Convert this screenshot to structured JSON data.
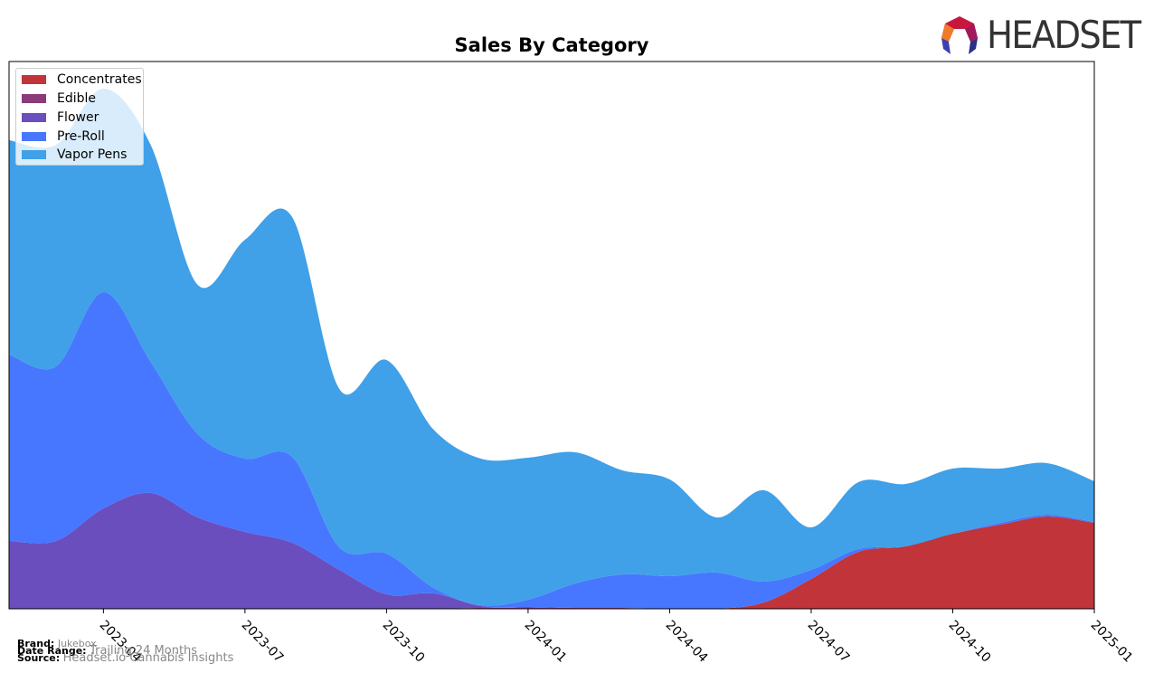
{
  "logo": {
    "text": "HEADSET"
  },
  "footer": {
    "brand_label": "Brand:",
    "brand_value": "Jukebox",
    "date_range_label": "Date Range:",
    "date_range_value": "Trailing 24 Months",
    "source_label": "Source:",
    "source_value": "Headset.io Cannabis Insights"
  },
  "chart_data": {
    "type": "area",
    "stacked": true,
    "title": "Sales By Category",
    "xlabel": "",
    "ylabel": "",
    "y_ticks_visible": false,
    "grid": false,
    "legend_position": "top-left",
    "x": [
      "2023-02",
      "2023-03",
      "2023-04",
      "2023-05",
      "2023-06",
      "2023-07",
      "2023-08",
      "2023-09",
      "2023-10",
      "2023-11",
      "2023-12",
      "2024-01",
      "2024-02",
      "2024-03",
      "2024-04",
      "2024-05",
      "2024-06",
      "2024-07",
      "2024-08",
      "2024-09",
      "2024-10",
      "2024-11",
      "2024-12",
      "2025-01"
    ],
    "x_tick_labels": [
      "2023-04",
      "2023-07",
      "2023-10",
      "2024-01",
      "2024-04",
      "2024-07",
      "2024-10",
      "2025-01"
    ],
    "ylim": [
      0,
      605
    ],
    "series": [
      {
        "name": "Concentrates",
        "color": "#c0343a",
        "values": [
          0,
          0,
          0,
          0,
          0,
          0,
          0,
          0,
          0,
          0,
          0,
          0,
          0,
          0,
          0,
          0,
          7,
          33,
          63,
          69,
          83,
          93,
          102,
          95
        ]
      },
      {
        "name": "Edible",
        "color": "#8b3a7a",
        "values": [
          0,
          0,
          0,
          0,
          0,
          0,
          0,
          0,
          0,
          0,
          1,
          1,
          1,
          1,
          0,
          0,
          0,
          0,
          0,
          0,
          0,
          0,
          0,
          0
        ]
      },
      {
        "name": "Flower",
        "color": "#6a4ebd",
        "values": [
          75,
          75,
          111,
          128,
          101,
          85,
          73,
          43,
          16,
          17,
          2,
          1,
          0,
          0,
          0,
          0,
          0,
          0,
          0,
          0,
          0,
          0,
          0,
          0
        ]
      },
      {
        "name": "Pre-Roll",
        "color": "#4776ff",
        "values": [
          206,
          193,
          239,
          145,
          92,
          81,
          95,
          25,
          45,
          6,
          1,
          8,
          27,
          37,
          36,
          40,
          23,
          10,
          3,
          0,
          0,
          2,
          2,
          1
        ]
      },
      {
        "name": "Vapor Pens",
        "color": "#40a0e8",
        "values": [
          237,
          245,
          225,
          240,
          165,
          242,
          265,
          175,
          214,
          175,
          162,
          157,
          145,
          115,
          107,
          61,
          101,
          47,
          74,
          69,
          72,
          60,
          57,
          45
        ]
      }
    ]
  }
}
